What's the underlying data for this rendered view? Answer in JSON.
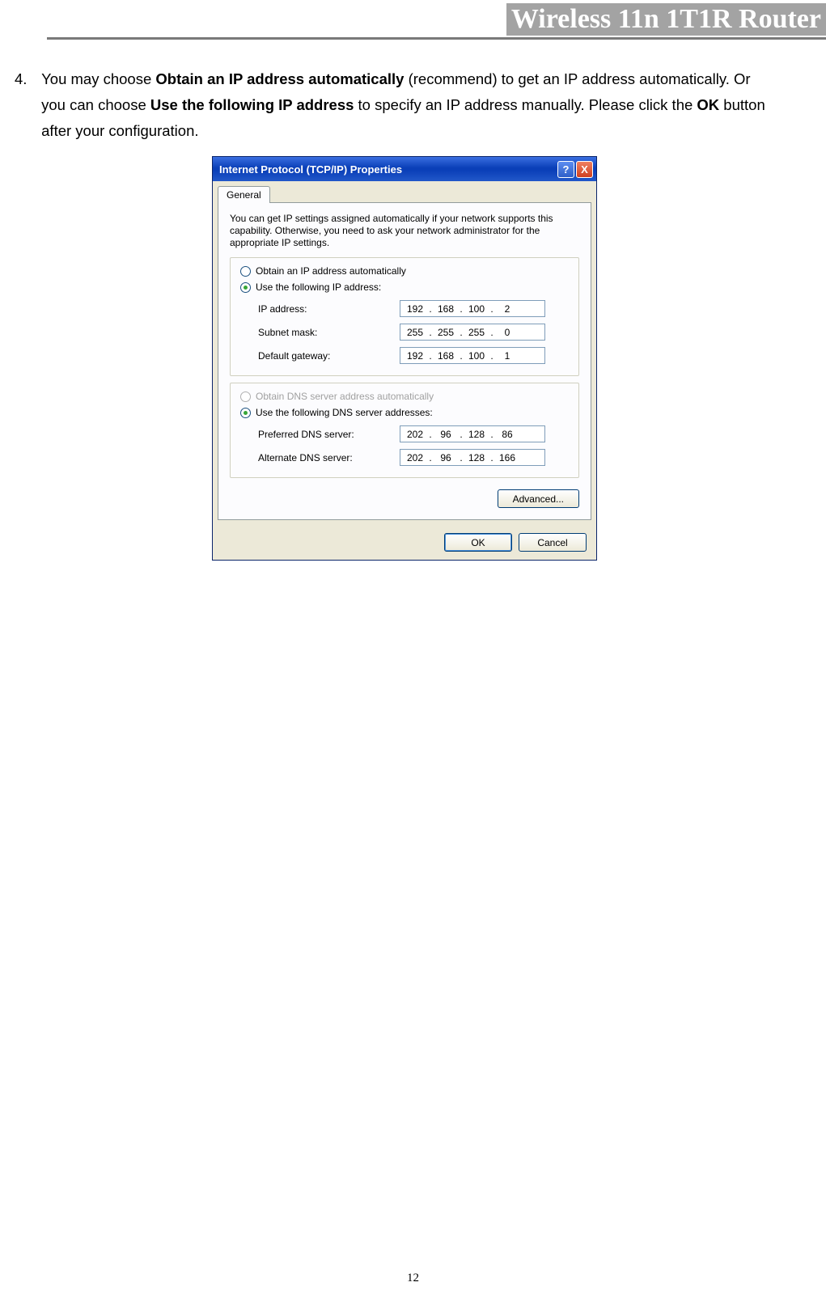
{
  "header": {
    "title": "Wireless 11n 1T1R Router"
  },
  "instruction": {
    "number": "4.",
    "text_p1": "You may choose ",
    "bold1": "Obtain an IP address automatically",
    "text_p2": " (recommend) to get an IP address automatically. Or you can choose ",
    "bold2": "Use the following IP address",
    "text_p3": " to specify an IP address manually. Please click the ",
    "bold3": "OK",
    "text_p4": " button after your configuration."
  },
  "dialog": {
    "title": "Internet Protocol (TCP/IP) Properties",
    "help_label": "?",
    "close_label": "X",
    "tab_general": "General",
    "description": "You can get IP settings assigned automatically if your network supports this capability. Otherwise, you need to ask your network administrator for the appropriate IP settings.",
    "radio_ip_auto": "Obtain an IP address automatically",
    "radio_ip_manual": "Use the following IP address:",
    "ip_address_label": "IP address:",
    "ip_address": [
      "192",
      "168",
      "100",
      "2"
    ],
    "subnet_label": "Subnet mask:",
    "subnet": [
      "255",
      "255",
      "255",
      "0"
    ],
    "gateway_label": "Default gateway:",
    "gateway": [
      "192",
      "168",
      "100",
      "1"
    ],
    "radio_dns_auto": "Obtain DNS server address automatically",
    "radio_dns_manual": "Use the following DNS server addresses:",
    "pref_dns_label": "Preferred DNS server:",
    "pref_dns": [
      "202",
      "96",
      "128",
      "86"
    ],
    "alt_dns_label": "Alternate DNS server:",
    "alt_dns": [
      "202",
      "96",
      "128",
      "166"
    ],
    "advanced_btn": "Advanced...",
    "ok_btn": "OK",
    "cancel_btn": "Cancel"
  },
  "page_number": "12"
}
